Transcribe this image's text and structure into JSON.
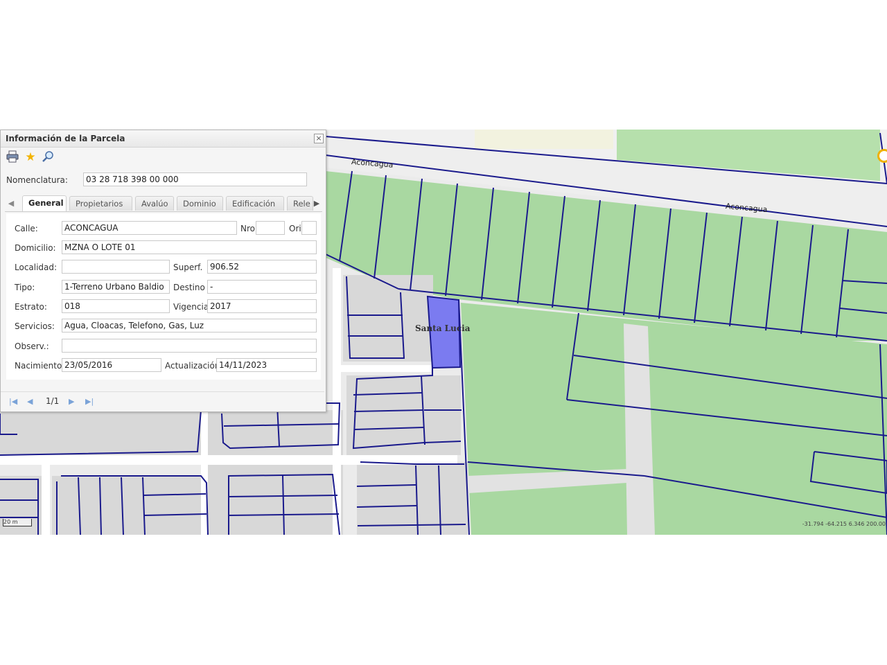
{
  "panel": {
    "title": "Información de la Parcela",
    "close_symbol": "×",
    "nomenclatura_label": "Nomenclatura:",
    "nomenclatura_value": "03 28 718 398 00 000",
    "tabs": [
      "General",
      "Propietarios",
      "Avalúo",
      "Dominio",
      "Edificación",
      "Rele"
    ],
    "active_tab": "General",
    "fields": {
      "calle_label": "Calle:",
      "calle_value": "ACONCAGUA",
      "nro_label": "Nro",
      "nro_value": "",
      "ori_label": "Ori",
      "ori_value": "",
      "domicilio_label": "Domicilio:",
      "domicilio_value": "MZNA O LOTE 01",
      "localidad_label": "Localidad:",
      "localidad_value": "",
      "superf_label": "Superf.",
      "superf_value": "906.52",
      "tipo_label": "Tipo:",
      "tipo_value": "1-Terreno Urbano Baldio",
      "destino_label": "Destino",
      "destino_value": "-",
      "estrato_label": "Estrato:",
      "estrato_value": "018",
      "vigencia_label": "Vigencia",
      "vigencia_value": "2017",
      "servicios_label": "Servicios:",
      "servicios_value": "Agua, Cloacas, Telefono, Gas, Luz",
      "observ_label": "Observ.:",
      "observ_value": "",
      "nacimiento_label": "Nacimiento:",
      "nacimiento_value": "23/05/2016",
      "actualizacion_label": "Actualización",
      "actualizacion_value": "14/11/2023"
    },
    "pager": {
      "page": "1/1"
    },
    "icons": [
      "print-icon",
      "star-icon",
      "search-icon",
      "first-page-icon",
      "prev-page-icon",
      "next-page-icon",
      "last-page-icon"
    ]
  },
  "map": {
    "street_label_1": "Aconcagua",
    "street_label_2": "Aconcagua",
    "place_label": "Santa Lucia",
    "scale_text": "20 m",
    "coords_text": "-31.794 -64.215  6.346 200.00",
    "colors": {
      "parcel_line": "#1a1a8c",
      "green": "#a8d8a0",
      "block": "#d9d9d9",
      "road": "#e8e8e8",
      "selected": "#7b7bf0"
    }
  }
}
